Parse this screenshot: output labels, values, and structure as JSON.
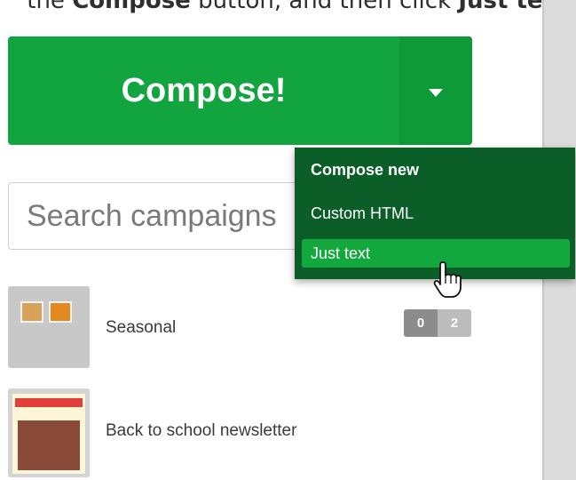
{
  "instruction": {
    "prefix": "the ",
    "compose_word": "Compose",
    "middle": " button, and then click ",
    "just_text_word": "Just text",
    "suffix": "."
  },
  "compose": {
    "label": "Compose!",
    "color": "#12a53f",
    "caret_icon": "caret-down-icon"
  },
  "search": {
    "placeholder": "Search campaigns"
  },
  "dropdown": {
    "background": "#0b5e28",
    "active_color": "#13a83e",
    "items": [
      {
        "label": "Compose new"
      },
      {
        "label": "Custom HTML"
      },
      {
        "label": "Just text"
      }
    ]
  },
  "campaigns": [
    {
      "name": "Seasonal",
      "badge_a": "0",
      "badge_b": "2"
    },
    {
      "name": "Back to school newsletter"
    }
  ],
  "cursor_icon": "hand-pointer-icon"
}
